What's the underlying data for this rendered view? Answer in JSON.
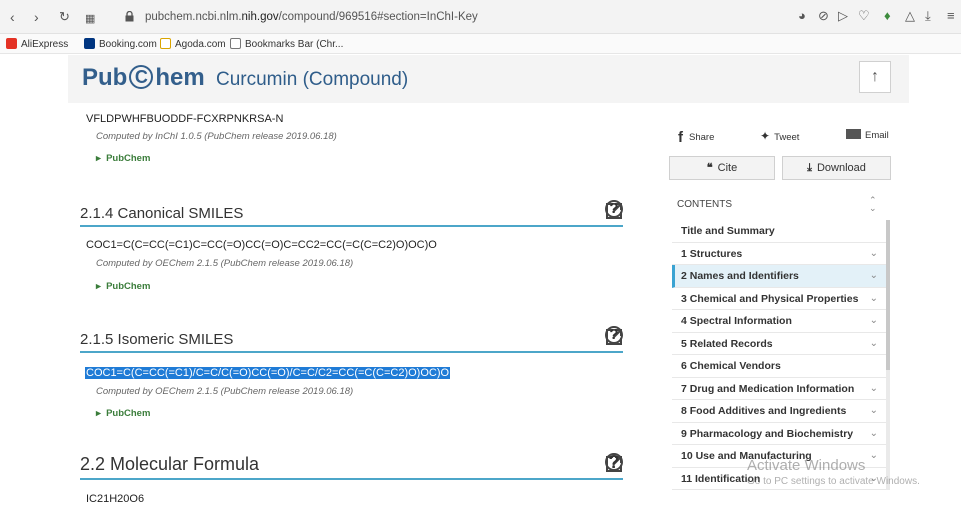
{
  "browser": {
    "url_prefix": "pubchem.ncbi.nlm.",
    "url_domain": "nih.gov",
    "url_path": "/compound/969516#section=InChI-Key",
    "bookmarks": [
      {
        "label": "AliExpress",
        "color": "#e43225"
      },
      {
        "label": "Booking.com",
        "color": "#003580"
      },
      {
        "label": "Agoda.com",
        "color": "#ffffff"
      },
      {
        "label": "Bookmarks Bar (Chr...",
        "color": "#ffffff"
      }
    ]
  },
  "header": {
    "logo_pub": "Pub",
    "logo_c": "C",
    "logo_hem": "hem",
    "title": "Curcumin (Compound)",
    "up_label": "↑"
  },
  "inchikey": {
    "value": "VFLDPWHFBUODDF-FCXRPNKRSA-N",
    "computed": "Computed by InChI 1.0.5 (PubChem release 2019.06.18)",
    "source": "PubChem"
  },
  "canonical": {
    "heading": "2.1.4  Canonical SMILES",
    "value": "COC1=C(C=CC(=C1)C=CC(=O)CC(=O)C=CC2=CC(=C(C=C2)O)OC)O",
    "computed": "Computed by OEChem 2.1.5 (PubChem release 2019.06.18)",
    "source": "PubChem"
  },
  "isomeric": {
    "heading": "2.1.5  Isomeric SMILES",
    "value": "COC1=C(C=CC(=C1)/C=C/C(=O)CC(=O)/C=C/C2=CC(=C(C=C2)O)OC)O",
    "computed": "Computed by OEChem 2.1.5 (PubChem release 2019.06.18)",
    "source": "PubChem"
  },
  "formula": {
    "heading": "2.2  Molecular Formula",
    "value": "IC21H20O6"
  },
  "sidebar": {
    "share": "Share",
    "tweet": "Tweet",
    "email": "Email",
    "cite": "Cite",
    "download": "Download",
    "contents": "CONTENTS",
    "toc": [
      {
        "label": "Title and Summary",
        "chevron": false,
        "active": false
      },
      {
        "label": "1 Structures",
        "chevron": true,
        "active": false
      },
      {
        "label": "2 Names and Identifiers",
        "chevron": true,
        "active": true
      },
      {
        "label": "3 Chemical and Physical Properties",
        "chevron": true,
        "active": false
      },
      {
        "label": "4 Spectral Information",
        "chevron": true,
        "active": false
      },
      {
        "label": "5 Related Records",
        "chevron": true,
        "active": false
      },
      {
        "label": "6 Chemical Vendors",
        "chevron": false,
        "active": false
      },
      {
        "label": "7 Drug and Medication Information",
        "chevron": true,
        "active": false
      },
      {
        "label": "8 Food Additives and Ingredients",
        "chevron": true,
        "active": false
      },
      {
        "label": "9 Pharmacology and Biochemistry",
        "chevron": true,
        "active": false
      },
      {
        "label": "10 Use and Manufacturing",
        "chevron": true,
        "active": false
      },
      {
        "label": "11 Identification",
        "chevron": true,
        "active": false
      }
    ]
  },
  "watermark": {
    "line1": "Activate Windows",
    "line2": "Go to PC settings to activate Windows."
  }
}
